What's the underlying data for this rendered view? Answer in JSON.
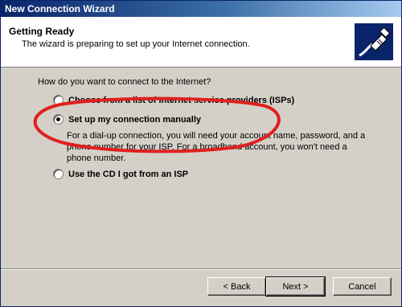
{
  "window": {
    "title": "New Connection Wizard"
  },
  "header": {
    "title": "Getting Ready",
    "subtitle": "The wizard is preparing to set up your Internet connection.",
    "icon": "network-cable-icon"
  },
  "body": {
    "question": "How do you want to connect to the Internet?",
    "options": [
      {
        "label": "Choose from a list of Internet service providers (ISPs)",
        "selected": false
      },
      {
        "label": "Set up my connection manually",
        "selected": true
      },
      {
        "label": "Use the CD I got from an ISP",
        "selected": false
      }
    ],
    "manual_description": "For a dial-up connection, you will need your account name, password, and a phone number for your ISP. For a broadband account, you won't need a phone number."
  },
  "footer": {
    "back_label": "< Back",
    "next_label": "Next >",
    "cancel_label": "Cancel"
  },
  "annotation_color": "#e02020"
}
